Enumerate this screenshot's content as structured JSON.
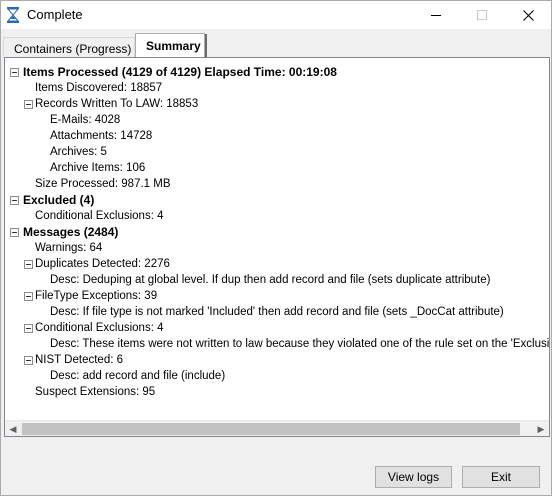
{
  "window": {
    "title": "Complete"
  },
  "tabs": [
    {
      "label": "Containers (Progress)"
    },
    {
      "label": "Summary"
    }
  ],
  "tree": [
    {
      "text": "Items Processed (4129 of 4129)  Elapsed Time: 00:19:08",
      "bold": true,
      "level": 0,
      "expander": true
    },
    {
      "text": "Items Discovered: 18857",
      "bold": false,
      "level": 1,
      "expander": false
    },
    {
      "text": "Records Written To LAW: 18853",
      "bold": false,
      "level": 1,
      "expander": true
    },
    {
      "text": "E-Mails: 4028",
      "bold": false,
      "level": 2,
      "expander": false
    },
    {
      "text": "Attachments: 14728",
      "bold": false,
      "level": 2,
      "expander": false
    },
    {
      "text": "Archives: 5",
      "bold": false,
      "level": 2,
      "expander": false
    },
    {
      "text": "Archive Items: 106",
      "bold": false,
      "level": 2,
      "expander": false
    },
    {
      "text": "Size Processed: 987.1 MB",
      "bold": false,
      "level": 1,
      "expander": false
    },
    {
      "text": "Excluded (4)",
      "bold": true,
      "level": 0,
      "expander": true
    },
    {
      "text": "Conditional Exclusions: 4",
      "bold": false,
      "level": 1,
      "expander": false
    },
    {
      "text": "Messages (2484)",
      "bold": true,
      "level": 0,
      "expander": true
    },
    {
      "text": "Warnings: 64",
      "bold": false,
      "level": 1,
      "expander": false
    },
    {
      "text": "Duplicates Detected: 2276",
      "bold": false,
      "level": 1,
      "expander": true
    },
    {
      "text": "Desc: Deduping at global level.  If dup then add record and file (sets duplicate attribute)",
      "bold": false,
      "level": 2,
      "expander": false
    },
    {
      "text": "FileType Exceptions: 39",
      "bold": false,
      "level": 1,
      "expander": true
    },
    {
      "text": "Desc: If file type is not marked 'Included' then add record and file (sets _DocCat attribute)",
      "bold": false,
      "level": 2,
      "expander": false
    },
    {
      "text": "Conditional Exclusions: 4",
      "bold": false,
      "level": 1,
      "expander": true
    },
    {
      "text": "Desc: These items were not written to law because they violated one of the rule set on the 'Exclusions' t",
      "bold": false,
      "level": 2,
      "expander": false
    },
    {
      "text": "NIST Detected: 6",
      "bold": false,
      "level": 1,
      "expander": true
    },
    {
      "text": "Desc: add record and file (include)",
      "bold": false,
      "level": 2,
      "expander": false
    },
    {
      "text": "Suspect Extensions: 95",
      "bold": false,
      "level": 1,
      "expander": false
    }
  ],
  "buttons": {
    "view_logs": "View logs",
    "exit": "Exit"
  },
  "icons": {
    "app": "hourglass-icon",
    "minimize": "minimize-icon",
    "maximize": "maximize-icon",
    "close": "close-icon",
    "scroll_left": "scroll-left-icon",
    "scroll_right": "scroll-right-icon"
  },
  "colors": {
    "panel_bg": "#ffffff",
    "window_bg": "#f0f0f0",
    "hourglass": "#2b6cb0"
  }
}
